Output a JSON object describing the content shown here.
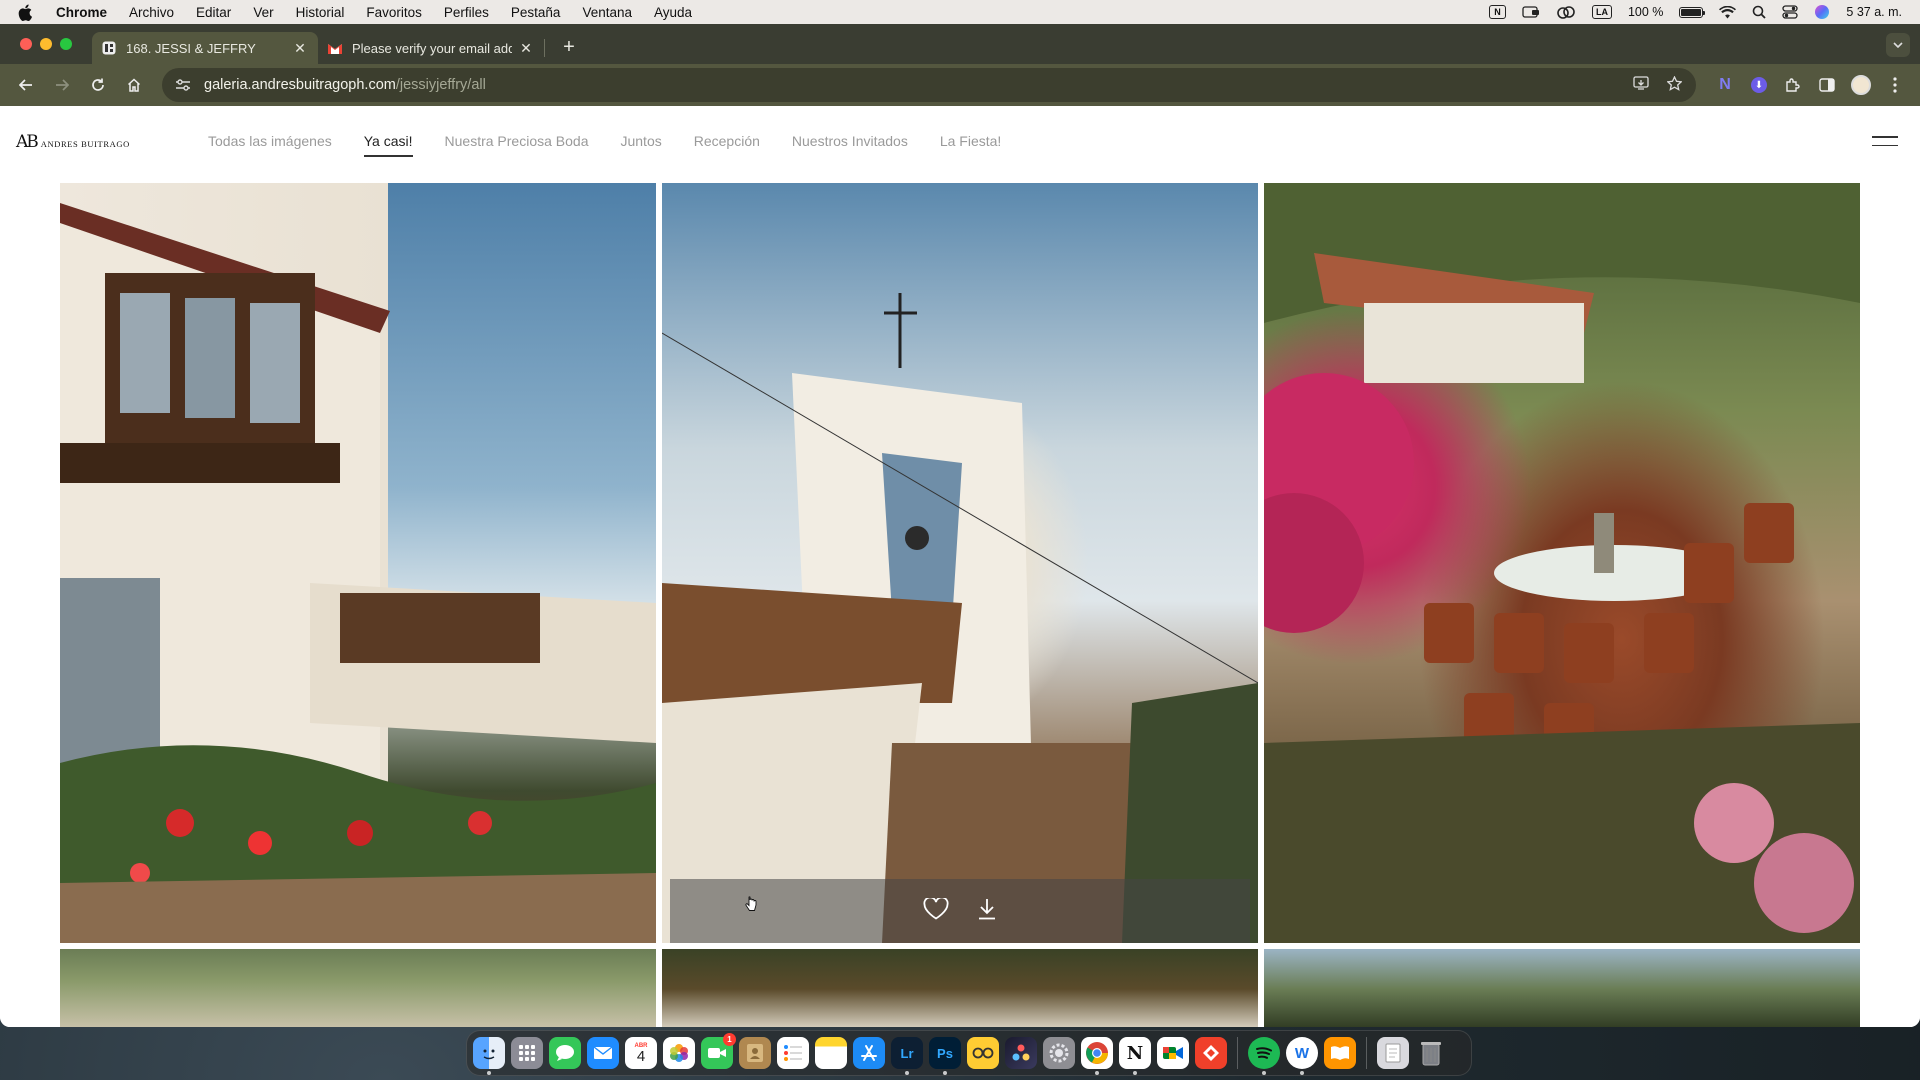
{
  "menubar": {
    "app_name": "Chrome",
    "items": [
      "Archivo",
      "Editar",
      "Ver",
      "Historial",
      "Favoritos",
      "Perfiles",
      "Pestaña",
      "Ventana",
      "Ayuda"
    ],
    "status": {
      "n_badge": "N",
      "la_badge": "LA",
      "battery_percent": "100 %",
      "clock": "5 37 a. m."
    }
  },
  "browser": {
    "tabs": [
      {
        "title": "168. JESSI & JEFFRY",
        "active": true
      },
      {
        "title": "Please verify your email addre",
        "active": false
      }
    ],
    "url": {
      "host": "galeria.andresbuitragoph.com",
      "path": "/jessiyjeffry/all"
    }
  },
  "site": {
    "logo": {
      "monogram": "AB",
      "name": "ANDRES BUITRAGO"
    },
    "nav": [
      "Todas las imágenes",
      "Ya casi!",
      "Nuestra Preciosa Boda",
      "Juntos",
      "Recepción",
      "Nuestros Invitados",
      "La Fiesta!"
    ],
    "active_nav": "Ya casi!"
  },
  "dock": {
    "calendar_day": "4",
    "calendar_month": "ABR",
    "facetime_badge": "1",
    "lightroom_label": "Lr",
    "photoshop_label": "Ps"
  },
  "colors": {
    "tab_strip": "#3a3d32",
    "toolbar": "#54573f",
    "accent_nav": "#222222"
  }
}
